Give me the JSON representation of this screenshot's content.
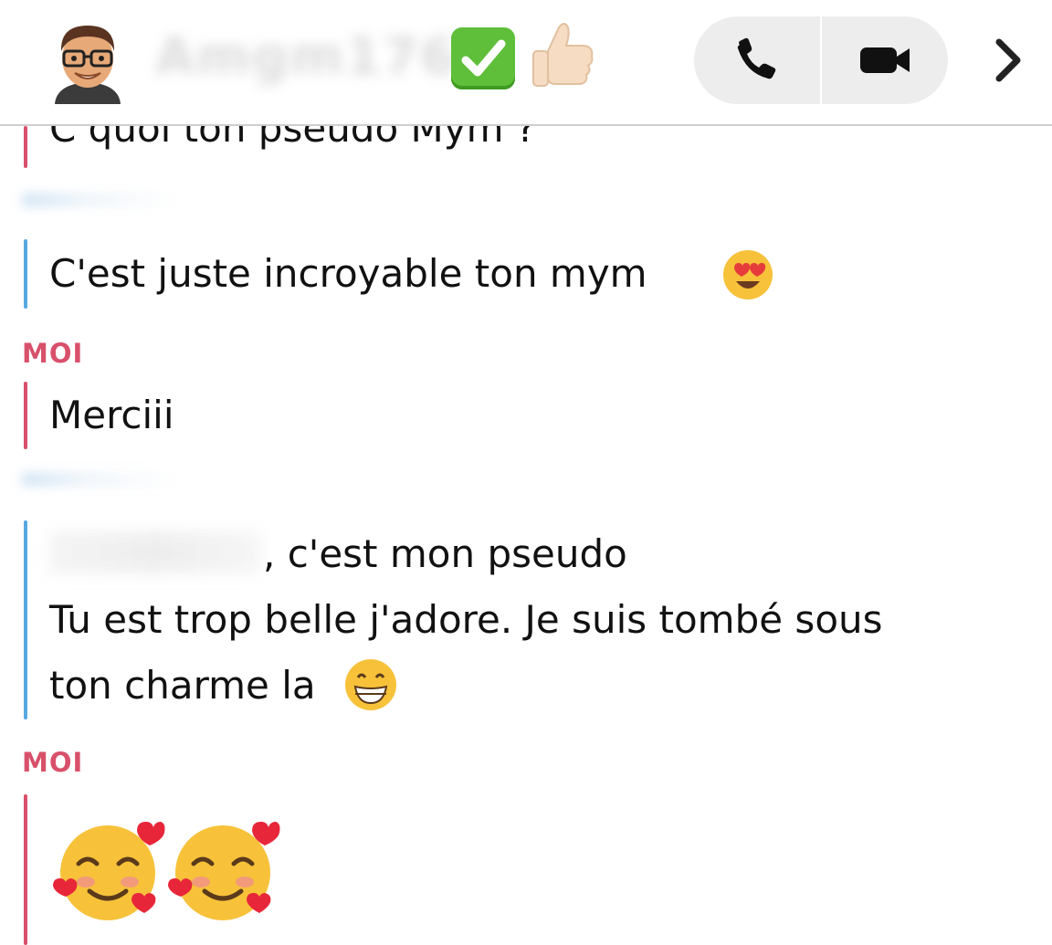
{
  "header": {
    "contact_name": "Amgm176",
    "badge_check_icon": "white-check-mark-emoji",
    "badge_thumb_icon": "thumbs-up-emoji",
    "call_icon": "phone-icon",
    "video_icon": "video-camera-icon",
    "more_icon": "chevron-right-icon"
  },
  "messages": [
    {
      "text": "C quoi ton pseudo Mym ?"
    },
    {
      "text": "C'est juste incroyable ton mym"
    },
    {
      "sender": "MOI",
      "text": "Merciii"
    },
    {
      "text_line1": ", c'est mon pseudo",
      "text_line2": "Tu est trop belle j'adore. Je suis tombé sous",
      "text_line3": "ton charme la"
    },
    {
      "sender": "MOI",
      "emoji": "smiling-face-with-hearts-emoji x2"
    }
  ],
  "colors": {
    "me_accent": "#d8506a",
    "them_accent": "#58a8e0",
    "call_pill": "#ededed"
  }
}
